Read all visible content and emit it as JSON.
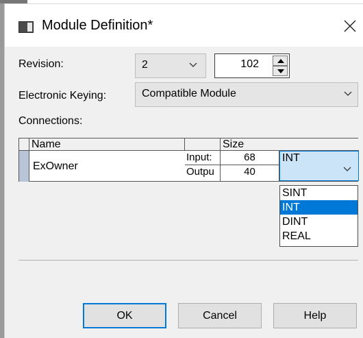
{
  "title": "Module Definition*",
  "revision": {
    "label": "Revision:",
    "major": "2",
    "minor": "102"
  },
  "keying": {
    "label": "Electronic Keying:",
    "value": "Compatible Module"
  },
  "connections": {
    "label": "Connections:",
    "headers": {
      "name": "Name",
      "size": "Size"
    },
    "row": {
      "name": "ExOwner",
      "input_label": "Input:",
      "input_size": "68",
      "output_label": "Outpu",
      "output_size": "40",
      "type": "INT"
    }
  },
  "type_options": [
    "SINT",
    "INT",
    "DINT",
    "REAL"
  ],
  "selected_type": "INT",
  "buttons": {
    "ok": "OK",
    "cancel": "Cancel",
    "help": "Help"
  },
  "colors": {
    "accent": "#0078d7",
    "selection_fill": "#cce4f7"
  },
  "icons": [
    "window-icon",
    "close-icon",
    "chevron-down-icon",
    "spin-up-icon",
    "spin-down-icon"
  ]
}
